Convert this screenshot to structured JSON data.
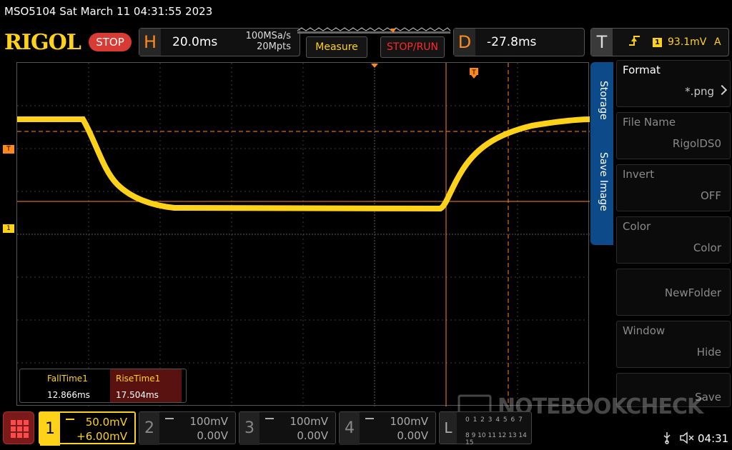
{
  "title": "MSO5104  Sat March 11 04:31:55 2023",
  "toolbar": {
    "logo": "RIGOL",
    "run_state": "STOP",
    "horizontal": {
      "letter": "H",
      "timebase": "20.0ms",
      "sample_rate": "100MSa/s",
      "memory_depth": "20Mpts"
    },
    "measure_label": "Measure",
    "stoprun_label": "STOP/RUN",
    "delay": {
      "letter": "D",
      "value": "-27.8ms"
    },
    "trigger": {
      "letter": "T",
      "source": "1",
      "level": "93.1mV",
      "mode": "A"
    }
  },
  "markers": {
    "trigger_level": "T",
    "channel1": "1"
  },
  "measurements": [
    {
      "name": "FallTime1",
      "value": "12.866ms"
    },
    {
      "name": "RiseTime1",
      "value": "17.504ms"
    }
  ],
  "side_menu": {
    "tabs": [
      "Storage",
      "Save Image"
    ],
    "items": [
      {
        "key": "Format",
        "value": "*.png",
        "enabled": true,
        "chevron": true
      },
      {
        "key": "File Name",
        "value": "RigolDS0",
        "enabled": false
      },
      {
        "key": "Invert",
        "value": "OFF",
        "enabled": false
      },
      {
        "key": "Color",
        "value": "Color",
        "enabled": false
      },
      {
        "key": "",
        "value": "NewFolder",
        "enabled": false
      },
      {
        "key": "Window",
        "value": "Hide",
        "enabled": false
      },
      {
        "key": "",
        "value": "Save",
        "enabled": false
      }
    ]
  },
  "channels": [
    {
      "num": "1",
      "scale": "50.0mV",
      "offset": "+6.00mV",
      "active": true
    },
    {
      "num": "2",
      "scale": "100mV",
      "offset": "0.00V",
      "active": false
    },
    {
      "num": "3",
      "scale": "100mV",
      "offset": "0.00V",
      "active": false
    },
    {
      "num": "4",
      "scale": "100mV",
      "offset": "0.00V",
      "active": false
    }
  ],
  "logic": {
    "letter": "L",
    "row1": "0 1 2 3 4 5 6 7",
    "row2": "8 9 10 11 12 13 14 15"
  },
  "status": {
    "clock": "04:31"
  },
  "watermark": "NOTEBOOKCHECK",
  "colors": {
    "ch1": "#ffd21a",
    "trigger": "#ff8a1a",
    "stop": "#d83a34",
    "menu_tab": "#0c4a8a"
  }
}
